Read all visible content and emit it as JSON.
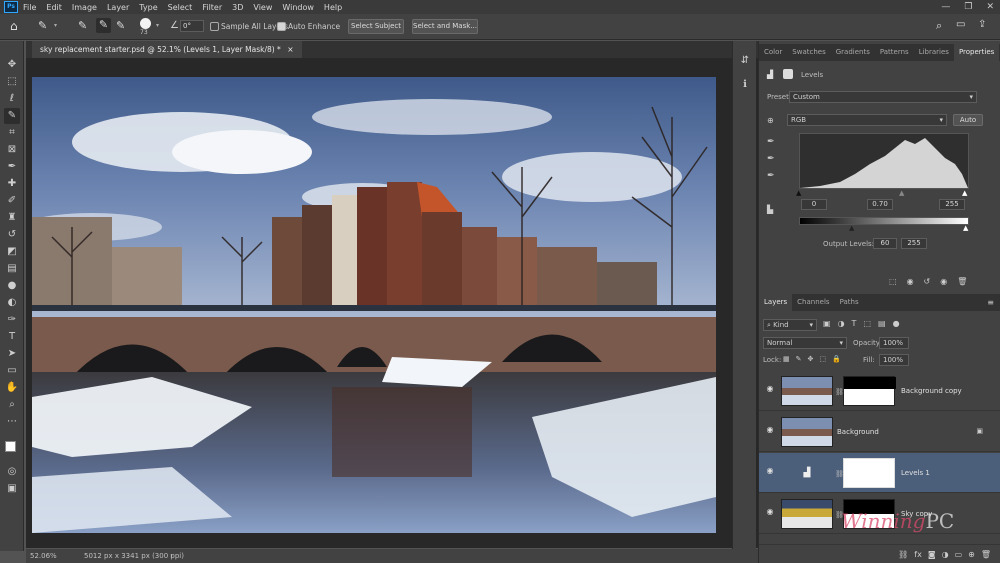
{
  "menu": {
    "items": [
      "File",
      "Edit",
      "Image",
      "Layer",
      "Type",
      "Select",
      "Filter",
      "3D",
      "View",
      "Window",
      "Help"
    ],
    "logo": "Ps",
    "window_controls": [
      "—",
      "❐",
      "✕"
    ]
  },
  "options_bar": {
    "brush_size": "73",
    "angle_value": "0°",
    "sample_all_layers_label": "Sample All Layers",
    "auto_enhance_label": "Auto Enhance",
    "select_subject_label": "Select Subject",
    "select_mask_label": "Select and Mask..."
  },
  "document_tab": {
    "title": "sky replacement starter.psd @ 52.1% (Levels 1, Layer Mask/8) *",
    "close": "×"
  },
  "status_bar": {
    "zoom": "52.06%",
    "doc_info": "5012 px x 3341 px (300 ppi)"
  },
  "properties_panel": {
    "tabs": [
      "Color",
      "Swatches",
      "Gradients",
      "Patterns",
      "Libraries",
      "Properties"
    ],
    "active_tab": "Properties",
    "adjustment_name": "Levels",
    "preset_label": "Preset:",
    "preset_value": "Custom",
    "channel_value": "RGB",
    "auto_label": "Auto",
    "input_black": "0",
    "input_gray": "0.70",
    "input_white": "255",
    "output_label": "Output Levels:",
    "output_black": "60",
    "output_white": "255"
  },
  "layers_panel": {
    "tabs": [
      "Layers",
      "Channels",
      "Paths"
    ],
    "active_tab": "Layers",
    "filter_label": "Kind",
    "blend_mode": "Normal",
    "opacity_label": "Opacity:",
    "opacity_value": "100%",
    "lock_label": "Lock:",
    "fill_label": "Fill:",
    "fill_value": "100%",
    "layers": [
      {
        "name": "Background copy",
        "selected": false
      },
      {
        "name": "Background",
        "selected": false
      },
      {
        "name": "Levels 1",
        "selected": true
      },
      {
        "name": "Sky copy",
        "selected": false
      }
    ]
  },
  "watermark": {
    "text1": "Winning",
    "text2": "PC"
  },
  "colors": {
    "selection_accent": "#4b5e7a",
    "panel_bg": "#424242",
    "photoshop_blue": "#31a8ff"
  }
}
